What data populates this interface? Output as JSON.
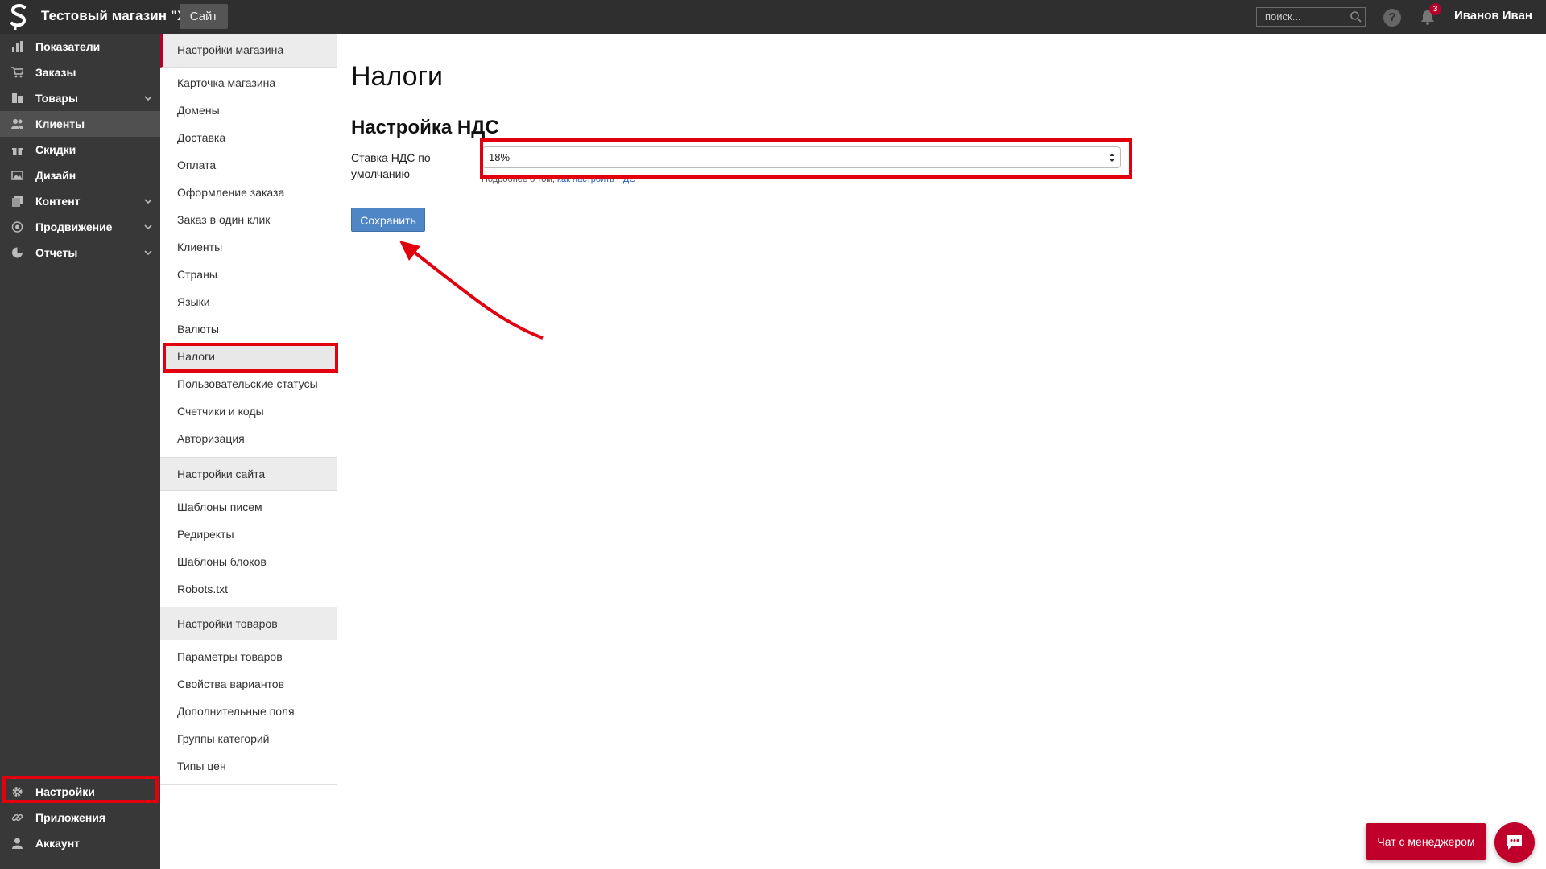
{
  "topbar": {
    "store_name": "Тестовый магазин \"ХМ\"",
    "site_button": "Сайт",
    "search_placeholder": "поиск...",
    "help_symbol": "?",
    "notifications_count": "3",
    "user_name": "Иванов Иван"
  },
  "sidebar": {
    "items": [
      {
        "label": "Показатели",
        "icon": "bar-chart-icon",
        "has_chevron": false,
        "active": false
      },
      {
        "label": "Заказы",
        "icon": "cart-icon",
        "has_chevron": false,
        "active": false
      },
      {
        "label": "Товары",
        "icon": "products-icon",
        "has_chevron": true,
        "active": false
      },
      {
        "label": "Клиенты",
        "icon": "users-icon",
        "has_chevron": false,
        "active": true
      },
      {
        "label": "Скидки",
        "icon": "gift-icon",
        "has_chevron": false,
        "active": false
      },
      {
        "label": "Дизайн",
        "icon": "image-icon",
        "has_chevron": false,
        "active": false
      },
      {
        "label": "Контент",
        "icon": "content-icon",
        "has_chevron": true,
        "active": false
      },
      {
        "label": "Продвижение",
        "icon": "target-icon",
        "has_chevron": true,
        "active": false
      },
      {
        "label": "Отчеты",
        "icon": "pie-chart-icon",
        "has_chevron": true,
        "active": false
      }
    ],
    "bottom_items": [
      {
        "label": "Настройки",
        "icon": "gear-icon"
      },
      {
        "label": "Приложения",
        "icon": "link-icon"
      },
      {
        "label": "Аккаунт",
        "icon": "user-icon"
      }
    ]
  },
  "submenu": {
    "sections": [
      {
        "title": "Настройки магазина",
        "items": [
          "Карточка магазина",
          "Домены",
          "Доставка",
          "Оплата",
          "Оформление заказа",
          "Заказ в один клик",
          "Клиенты",
          "Страны",
          "Языки",
          "Валюты",
          "Налоги",
          "Пользовательские статусы",
          "Счетчики и коды",
          "Авторизация"
        ]
      },
      {
        "title": "Настройки сайта",
        "items": [
          "Шаблоны писем",
          "Редиректы",
          "Шаблоны блоков",
          "Robots.txt"
        ]
      },
      {
        "title": "Настройки товаров",
        "items": [
          "Параметры товаров",
          "Свойства вариантов",
          "Дополнительные поля",
          "Группы категорий",
          "Типы цен"
        ]
      }
    ],
    "selected": "Налоги"
  },
  "main": {
    "page_title": "Налоги",
    "section_title": "Настройка НДС",
    "vat_label": "Ставка НДС по умолчанию",
    "vat_value": "18%",
    "hint_text": "Подробнее о том, ",
    "hint_link": "как настроить НДС",
    "save_label": "Сохранить"
  },
  "chat": {
    "label": "Чат с менеджером"
  },
  "colors": {
    "topbar": "#2f2f2f",
    "sidebar": "#383838",
    "accent": "#b5002a",
    "save_button": "#4f86c6",
    "annotation": "#e2000f"
  }
}
